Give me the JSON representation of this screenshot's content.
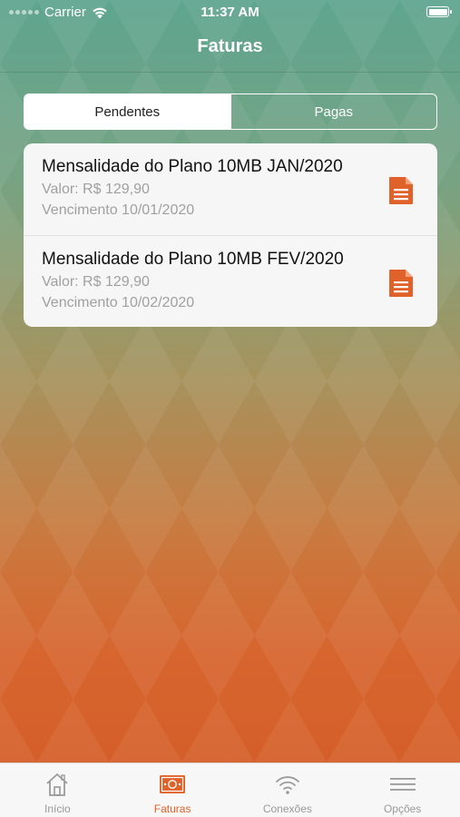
{
  "status_bar": {
    "carrier": "Carrier",
    "time": "11:37 AM",
    "battery_level": 1.0
  },
  "header": {
    "title": "Faturas"
  },
  "segments": {
    "items": [
      {
        "label": "Pendentes",
        "selected": true
      },
      {
        "label": "Pagas",
        "selected": false
      }
    ]
  },
  "invoices": [
    {
      "title": "Mensalidade do Plano 10MB JAN/2020",
      "value": "Valor: R$ 129,90",
      "due": "Vencimento 10/01/2020",
      "icon": "document-icon"
    },
    {
      "title": "Mensalidade do Plano 10MB FEV/2020",
      "value": "Valor: R$ 129,90",
      "due": "Vencimento 10/02/2020",
      "icon": "document-icon"
    }
  ],
  "tab_bar": {
    "tabs": [
      {
        "label": "Início",
        "icon": "home-icon",
        "active": false
      },
      {
        "label": "Faturas",
        "icon": "invoice-icon",
        "active": true
      },
      {
        "label": "Conexões",
        "icon": "wifi-icon",
        "active": false
      },
      {
        "label": "Opções",
        "icon": "menu-icon",
        "active": false
      }
    ]
  },
  "colors": {
    "accent": "#e0622a",
    "gradient_top": "#5ea58f",
    "gradient_bottom": "#d45b27",
    "tab_inactive": "#9a9a9a"
  }
}
